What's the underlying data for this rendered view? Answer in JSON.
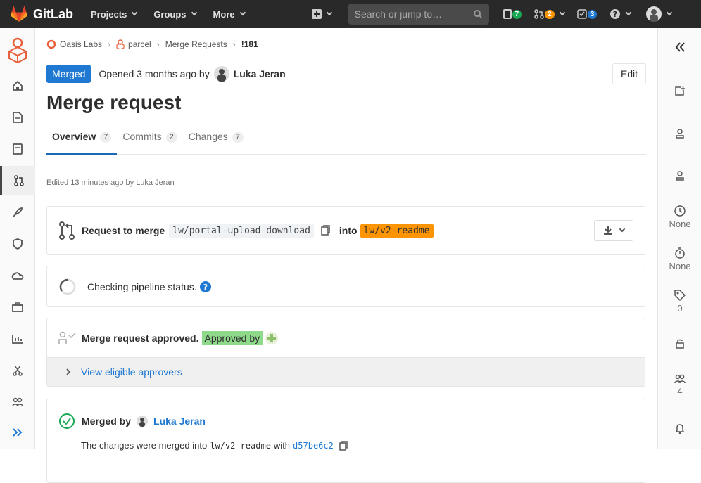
{
  "header": {
    "brand": "GitLab",
    "nav": [
      "Projects",
      "Groups",
      "More"
    ],
    "search_placeholder": "Search or jump to…",
    "issues_count": "7",
    "mr_count": "2",
    "todos_count": "3"
  },
  "breadcrumb": {
    "group": "Oasis Labs",
    "project": "parcel",
    "section": "Merge Requests",
    "mr": "!181"
  },
  "status": {
    "badge": "Merged",
    "opened_text": "Opened 3 months ago by",
    "author": "Luka Jeran",
    "edit_label": "Edit"
  },
  "title": "Merge request",
  "tabs": [
    {
      "label": "Overview",
      "count": "7"
    },
    {
      "label": "Commits",
      "count": "2"
    },
    {
      "label": "Changes",
      "count": "7"
    }
  ],
  "edited": "Edited 13 minutes ago by Luka Jeran",
  "merge_request": {
    "label": "Request to merge",
    "source": "lw/portal-upload-download",
    "into": "into",
    "target": "lw/v2-readme"
  },
  "pipeline": {
    "text": "Checking pipeline status."
  },
  "approval": {
    "text": "Merge request approved.",
    "approved_by": "Approved by",
    "view_link": "View eligible approvers"
  },
  "merged": {
    "label": "Merged by",
    "author": "Luka Jeran",
    "desc_prefix": "The changes were merged into",
    "branch": "lw/v2-readme",
    "with": "with",
    "commit": "d57be6c2"
  },
  "right_sidebar": {
    "milestone": "None",
    "time": "None",
    "labels": "0",
    "participants": "4"
  },
  "colors": {
    "topbar": "#292929",
    "blue": "#1f78d1",
    "green": "#1aaa55",
    "orange": "#fc9403"
  }
}
